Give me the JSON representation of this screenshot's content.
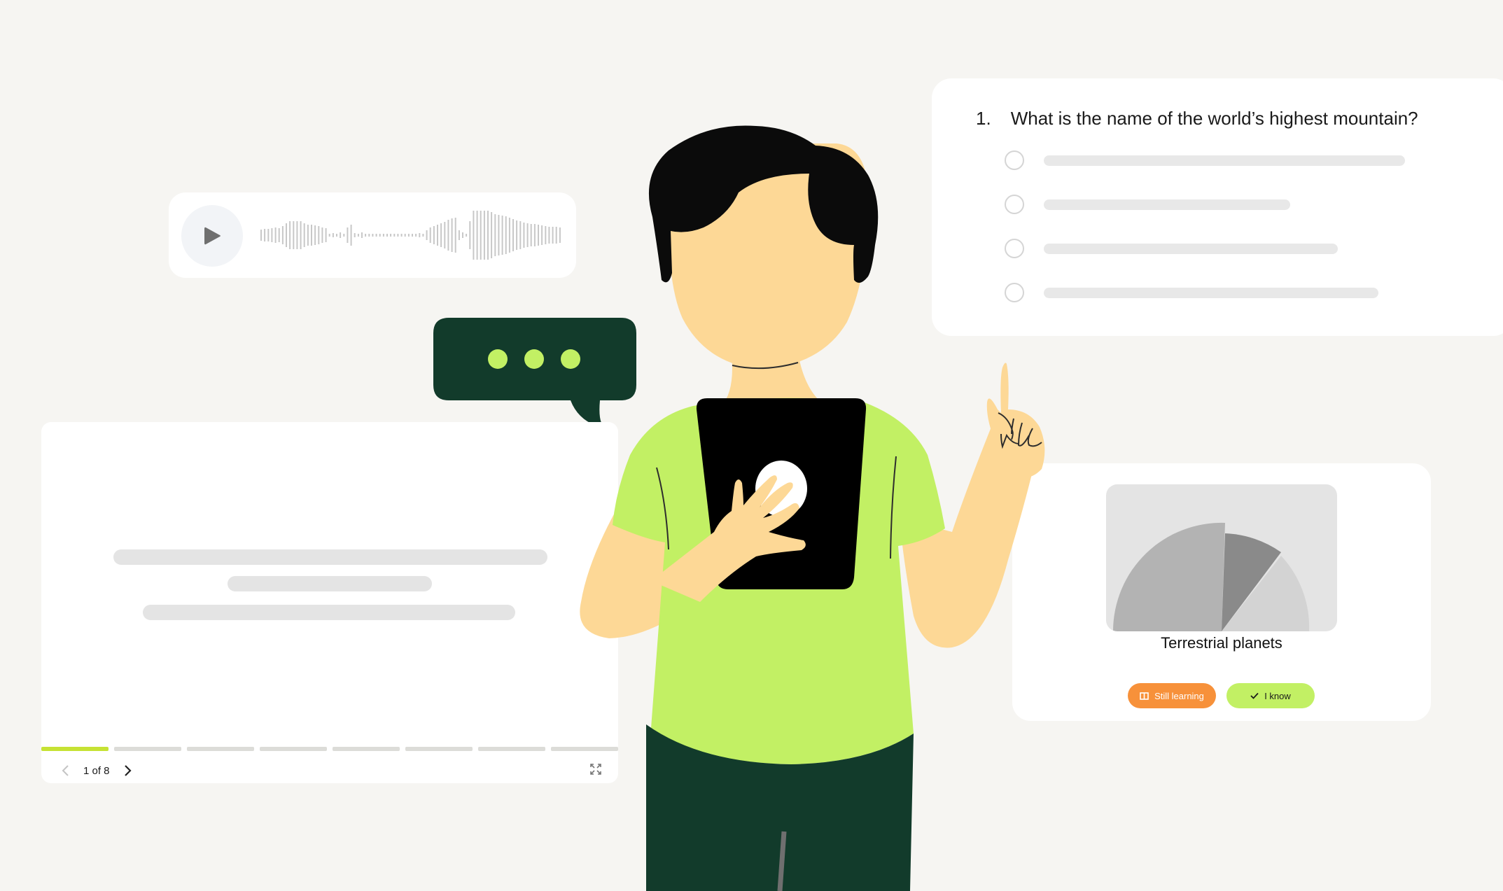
{
  "audio_player": {
    "play_icon": "play-icon",
    "waveform_icon": "audio-waveform"
  },
  "chat_bubble": {
    "icon": "typing-indicator-dots",
    "color": "#123b2b",
    "dot_color": "#c2f064"
  },
  "flashcard": {
    "pager_text": "1 of 8",
    "current_page": 1,
    "total_pages": 8,
    "prev_icon": "chevron-left-icon",
    "next_icon": "chevron-right-icon",
    "expand_icon": "expand-icon",
    "accent_color": "#c6e234"
  },
  "quiz": {
    "number": "1.",
    "question": "What is the name of the world’s highest mountain?",
    "options_count": 4
  },
  "planet_card": {
    "title": "Terrestrial planets",
    "still_learning_label": "Still learning",
    "still_learning_icon": "book-icon",
    "i_know_label": "I know",
    "i_know_icon": "check-icon",
    "still_learning_color": "#f7913a",
    "i_know_color": "#c2f064"
  },
  "illustration": {
    "subject": "person holding tablet pointing up",
    "shirt_color": "#c2f064",
    "pants_color": "#123b2b",
    "skin_color": "#fdd896",
    "hair_color": "#0b0b0b"
  }
}
